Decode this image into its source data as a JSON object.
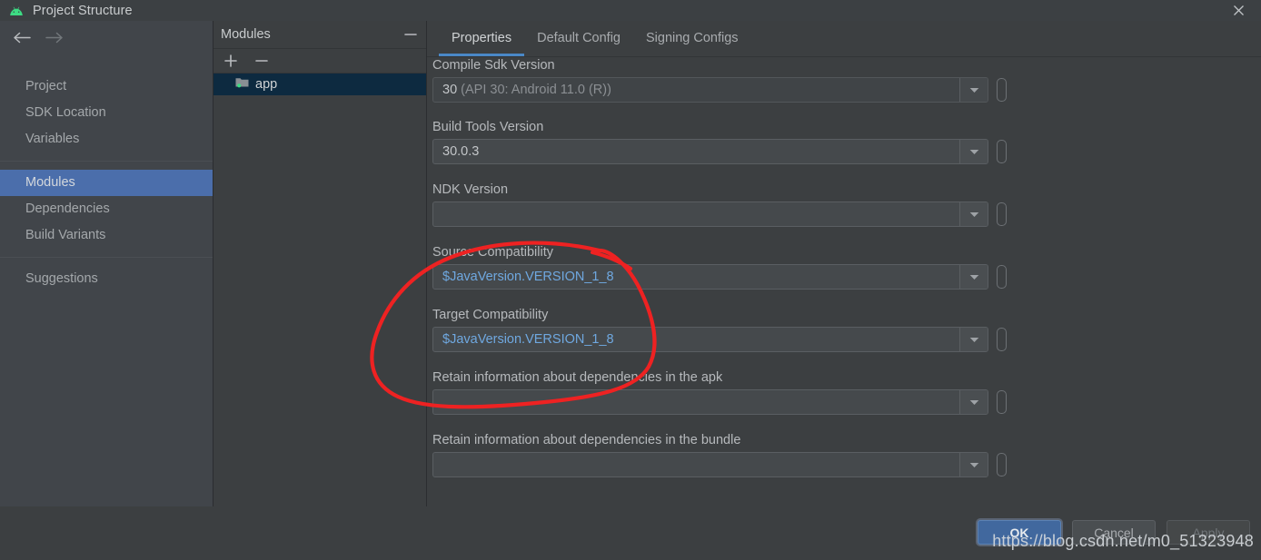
{
  "window": {
    "title": "Project Structure",
    "app_icon": "android-icon",
    "close_icon": "close-icon"
  },
  "nav": {
    "back_icon": "arrow-left-icon",
    "forward_icon": "arrow-right-icon"
  },
  "sidebar": {
    "items": [
      {
        "label": "Project",
        "selected": false
      },
      {
        "label": "SDK Location",
        "selected": false
      },
      {
        "label": "Variables",
        "selected": false
      },
      {
        "label": "Modules",
        "selected": true
      },
      {
        "label": "Dependencies",
        "selected": false
      },
      {
        "label": "Build Variants",
        "selected": false
      },
      {
        "label": "Suggestions",
        "selected": false
      }
    ]
  },
  "modules_panel": {
    "title": "Modules",
    "collapse_icon": "minimize-icon",
    "add_icon": "plus-icon",
    "remove_icon": "minus-icon",
    "modules": [
      {
        "label": "app",
        "icon": "module-folder-icon",
        "selected": true
      }
    ]
  },
  "properties": {
    "tabs": [
      {
        "label": "Properties",
        "active": true
      },
      {
        "label": "Default Config",
        "active": false
      },
      {
        "label": "Signing Configs",
        "active": false
      }
    ],
    "fields": [
      {
        "label": "Compile Sdk Version",
        "value": "30",
        "value_suffix": " (API 30: Android 11.0 (R))",
        "variable": false,
        "disabled": true
      },
      {
        "label": "Build Tools Version",
        "value": "30.0.3",
        "value_suffix": "",
        "variable": false,
        "disabled": false
      },
      {
        "label": "NDK Version",
        "value": "",
        "value_suffix": "",
        "variable": false,
        "disabled": false
      },
      {
        "label": "Source Compatibility",
        "value": "$JavaVersion.VERSION_1_8",
        "value_suffix": "",
        "variable": true,
        "disabled": false
      },
      {
        "label": "Target Compatibility",
        "value": "$JavaVersion.VERSION_1_8",
        "value_suffix": "",
        "variable": true,
        "disabled": false
      },
      {
        "label": "Retain information about dependencies in the apk",
        "value": "",
        "value_suffix": "",
        "variable": false,
        "disabled": false
      },
      {
        "label": "Retain information about dependencies in the bundle",
        "value": "",
        "value_suffix": "",
        "variable": false,
        "disabled": false
      }
    ]
  },
  "footer": {
    "ok_label": "OK",
    "cancel_label": "Cancel",
    "apply_label": "Apply",
    "watermark": "https://blog.csdn.net/m0_51323948"
  },
  "colors": {
    "accent_blue": "#4a88c7",
    "selection_blue": "#4b6eab",
    "variable_text": "#6fa8e0",
    "annotation_red": "#ee2222",
    "panel_bg": "#3c3f41",
    "sidebar_bg": "#41454a"
  }
}
